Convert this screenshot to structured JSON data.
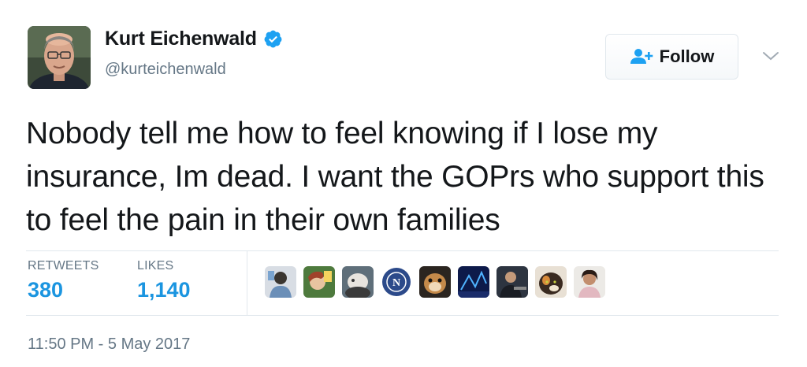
{
  "author": {
    "display_name": "Kurt Eichenwald",
    "handle": "@kurteichenwald",
    "verified": true,
    "avatar_icon": "profile-photo"
  },
  "follow_button": {
    "label": "Follow",
    "icon": "add-user-icon"
  },
  "menu_icon": "chevron-down-icon",
  "tweet": {
    "text": "Nobody tell me how to feel knowing if I lose my insurance, Im dead. I want the GOPrs who support this to feel the pain in their own families"
  },
  "stats": {
    "retweets_label": "RETWEETS",
    "retweets_value": "380",
    "likes_label": "LIKES",
    "likes_value": "1,140"
  },
  "likers": [
    {
      "name": "liker-avatar-1",
      "icon": "avatar-photo"
    },
    {
      "name": "liker-avatar-2",
      "icon": "avatar-photo"
    },
    {
      "name": "liker-avatar-3",
      "icon": "avatar-photo"
    },
    {
      "name": "liker-avatar-4",
      "icon": "avatar-logo"
    },
    {
      "name": "liker-avatar-5",
      "icon": "avatar-photo"
    },
    {
      "name": "liker-avatar-6",
      "icon": "avatar-photo"
    },
    {
      "name": "liker-avatar-7",
      "icon": "avatar-photo"
    },
    {
      "name": "liker-avatar-8",
      "icon": "avatar-photo"
    },
    {
      "name": "liker-avatar-9",
      "icon": "avatar-photo"
    }
  ],
  "timestamp": "11:50 PM - 5 May 2017",
  "colors": {
    "link_blue": "#1b95e0",
    "verified_blue": "#1da1f2",
    "secondary_text": "#657786",
    "border": "#e1e8ed"
  }
}
